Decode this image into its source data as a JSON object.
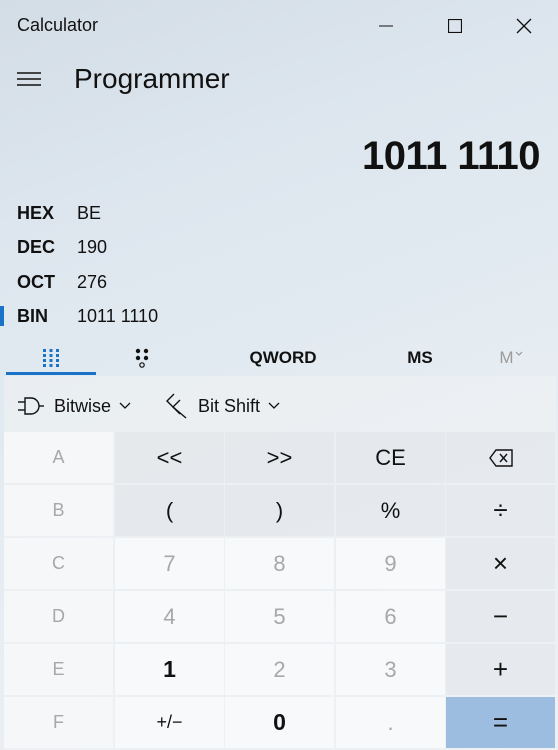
{
  "window": {
    "title": "Calculator"
  },
  "header": {
    "mode": "Programmer"
  },
  "display": {
    "value": "1011 1110"
  },
  "radix": [
    {
      "name": "HEX",
      "value": "BE",
      "selected": false
    },
    {
      "name": "DEC",
      "value": "190",
      "selected": false
    },
    {
      "name": "OCT",
      "value": "276",
      "selected": false
    },
    {
      "name": "BIN",
      "value": "1011 1110",
      "selected": true
    }
  ],
  "tabs": {
    "word_size": "QWORD",
    "memory_store": "MS",
    "memory_list": "M"
  },
  "ops": {
    "bitwise": "Bitwise",
    "bitshift": "Bit Shift"
  },
  "keys": [
    [
      "A",
      "<<",
      ">>",
      "CE",
      "backspace"
    ],
    [
      "B",
      "(",
      ")",
      "%",
      "÷"
    ],
    [
      "C",
      "7",
      "8",
      "9",
      "×"
    ],
    [
      "D",
      "4",
      "5",
      "6",
      "−"
    ],
    [
      "E",
      "1",
      "2",
      "3",
      "+"
    ],
    [
      "F",
      "+/−",
      "0",
      ".",
      "="
    ]
  ],
  "colors": {
    "accent": "#1a73c7",
    "equals": "#9dbde0"
  }
}
